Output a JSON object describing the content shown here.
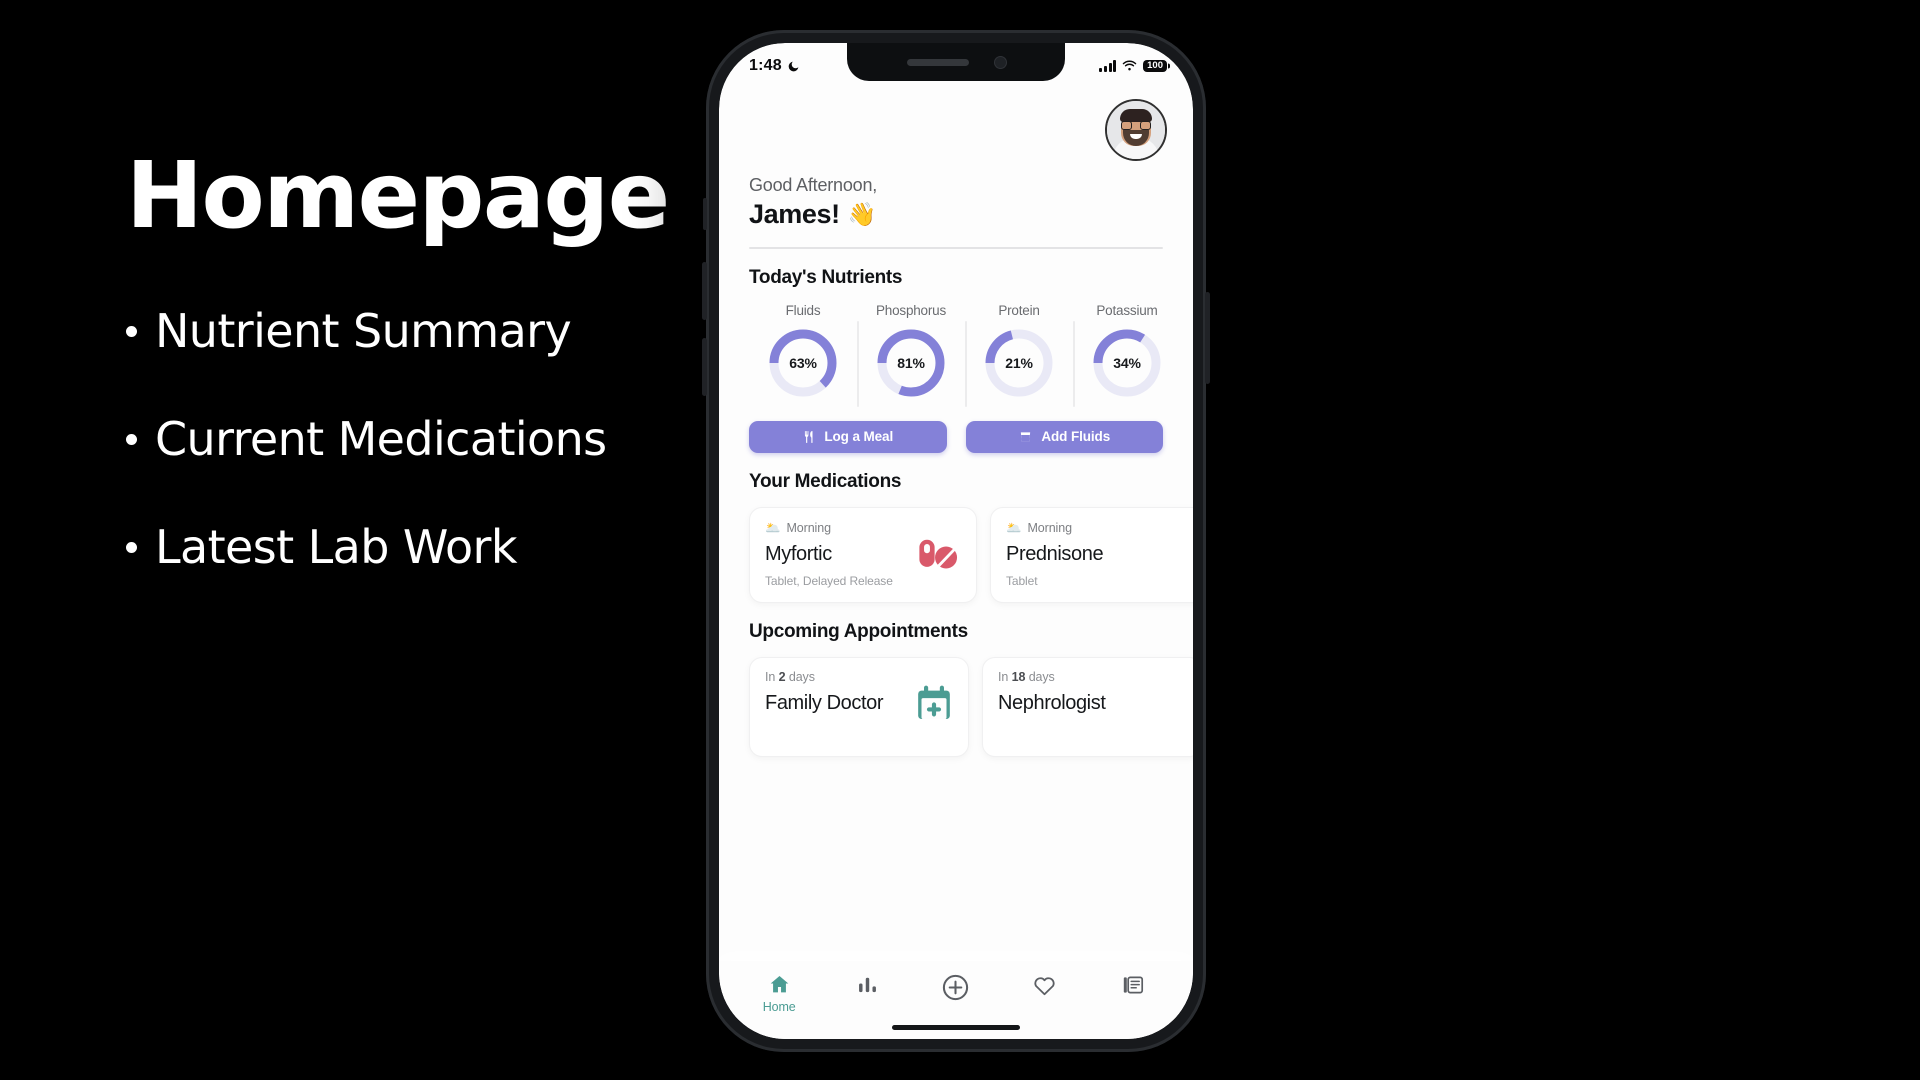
{
  "promo": {
    "title": "Homepage",
    "bullets": [
      {
        "label": "Nutrient Summary"
      },
      {
        "label": "Current Medications"
      },
      {
        "label": "Latest Lab Work"
      }
    ]
  },
  "colors": {
    "accent_purple": "#8481d8",
    "ring_track": "#e9e9f6",
    "teal": "#4b9c93",
    "pill_red": "#d9596a",
    "frame": "#17191c"
  },
  "status_bar": {
    "time": "1:48",
    "dnd_icon": "crescent-moon-icon",
    "signal_icon": "cellular-bars-icon",
    "wifi_icon": "wifi-icon",
    "battery": "100"
  },
  "header": {
    "avatar_alt": "user-avatar",
    "greeting": "Good Afternoon,",
    "name": "James!",
    "wave_emoji": "👋"
  },
  "nutrients": {
    "section_title": "Today's Nutrients",
    "items": [
      {
        "label": "Fluids",
        "percent": 63,
        "value_text": "63%"
      },
      {
        "label": "Phosphorus",
        "percent": 81,
        "value_text": "81%"
      },
      {
        "label": "Protein",
        "percent": 21,
        "value_text": "21%"
      },
      {
        "label": "Potassium",
        "percent": 34,
        "value_text": "34%"
      }
    ],
    "actions": [
      {
        "label": "Log a Meal",
        "icon": "fork-knife-icon"
      },
      {
        "label": "Add Fluids",
        "icon": "drinking-glass-icon"
      }
    ]
  },
  "medications": {
    "section_title": "Your Medications",
    "items": [
      {
        "time_of_day": "Morning",
        "time_icon": "sun-behind-cloud-icon",
        "name": "Myfortic",
        "form": "Tablet, Delayed Release",
        "icon": "pills-icon"
      },
      {
        "time_of_day": "Morning",
        "time_icon": "sun-behind-cloud-icon",
        "name": "Prednisone",
        "form": "Tablet",
        "icon": "pills-icon"
      }
    ]
  },
  "appointments": {
    "section_title": "Upcoming Appointments",
    "items": [
      {
        "when_prefix": "In",
        "when_value": "2",
        "when_suffix": "days",
        "title": "Family Doctor",
        "icon": "calendar-plus-icon"
      },
      {
        "when_prefix": "In",
        "when_value": "18",
        "when_suffix": "days",
        "title": "Nephrologist",
        "icon": "calendar-plus-icon"
      }
    ]
  },
  "tabbar": {
    "items": [
      {
        "icon": "home-icon",
        "label": "Home",
        "active": true
      },
      {
        "icon": "bar-chart-icon",
        "label": "",
        "active": false
      },
      {
        "icon": "plus-circle-icon",
        "label": "",
        "active": false
      },
      {
        "icon": "heart-icon",
        "label": "",
        "active": false
      },
      {
        "icon": "article-icon",
        "label": "",
        "active": false
      }
    ]
  }
}
